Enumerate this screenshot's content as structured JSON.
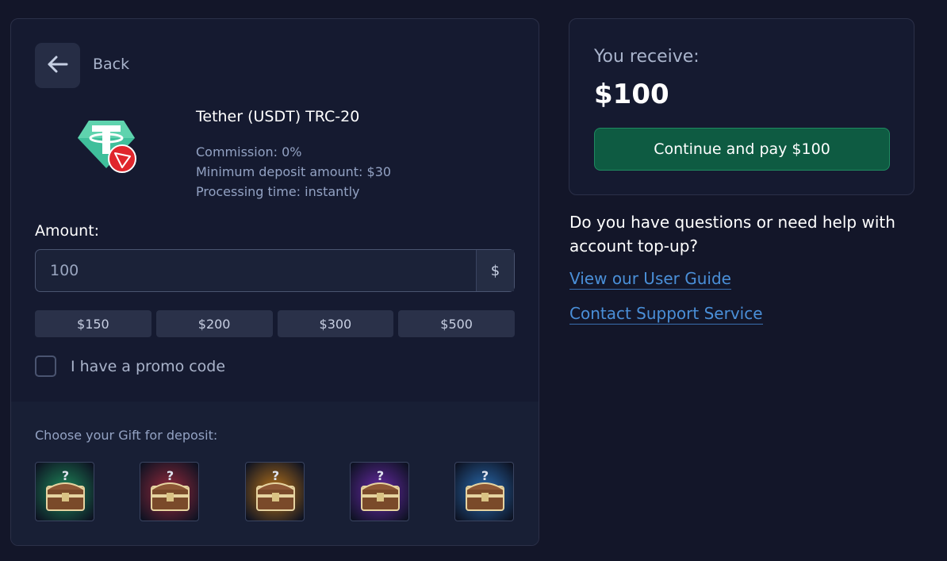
{
  "back": {
    "label": "Back",
    "icon": "arrow-left-icon"
  },
  "method": {
    "title": "Tether (USDT) TRC-20",
    "commission": "Commission: 0%",
    "minimum": "Minimum deposit amount: $30",
    "processing": "Processing time: instantly",
    "icon": "tether-trc20-icon",
    "colors": {
      "tether": "#3fbf9b",
      "tron": "#e0262c"
    }
  },
  "amount": {
    "label": "Amount:",
    "value": "100",
    "currency": "$",
    "presets": [
      "$150",
      "$200",
      "$300",
      "$500"
    ]
  },
  "promo": {
    "label": "I have a promo code",
    "checked": false
  },
  "gifts": {
    "title": "Choose your Gift for deposit:",
    "items": [
      {
        "color": "#1f8a5a",
        "icon": "mystery-chest-icon"
      },
      {
        "color": "#9a2a3c",
        "icon": "mystery-chest-icon"
      },
      {
        "color": "#b8741a",
        "icon": "mystery-chest-icon"
      },
      {
        "color": "#6a2aa8",
        "icon": "mystery-chest-icon"
      },
      {
        "color": "#2a6cb0",
        "icon": "mystery-chest-icon"
      }
    ]
  },
  "summary": {
    "receive_label": "You receive:",
    "receive_value": "$100",
    "pay_button": "Continue and pay $100",
    "accent": "#0e5b42"
  },
  "help": {
    "question": "Do you have questions or need help with account top-up?",
    "guide_link": "View our User Guide",
    "support_link": "Contact Support Service",
    "link_color": "#4a8fd8"
  }
}
